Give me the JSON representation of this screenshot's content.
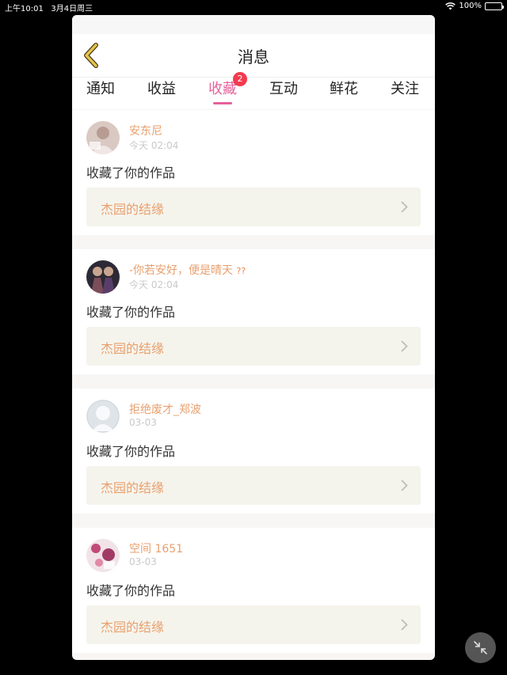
{
  "status_bar": {
    "time": "上午10:01",
    "date": "3月4日周三",
    "battery_percent": "100%",
    "wifi_icon": "wifi-icon",
    "battery_icon": "battery-icon",
    "battery_level": 1.0
  },
  "header": {
    "title": "消息",
    "back_icon": "chevron-left-icon"
  },
  "tabs": [
    {
      "label": "通知",
      "active": false,
      "badge": ""
    },
    {
      "label": "收益",
      "active": false,
      "badge": ""
    },
    {
      "label": "收藏",
      "active": true,
      "badge": "2"
    },
    {
      "label": "互动",
      "active": false,
      "badge": ""
    },
    {
      "label": "鲜花",
      "active": false,
      "badge": ""
    },
    {
      "label": "关注",
      "active": false,
      "badge": ""
    }
  ],
  "messages": [
    {
      "user": "安东尼",
      "time": "今天 02:04",
      "action": "收藏了你的作品",
      "work": "杰园的结缘"
    },
    {
      "user": "-你若安好，便是晴天",
      "emoji": "??",
      "time": "今天 02:04",
      "action": "收藏了你的作品",
      "work": "杰园的结缘"
    },
    {
      "user": "拒绝废才_郑波",
      "time": "03-03",
      "action": "收藏了你的作品",
      "work": "杰园的结缘"
    },
    {
      "user": "空间 1651",
      "time": "03-03",
      "action": "收藏了你的作品",
      "work": "杰园的结缘"
    }
  ],
  "colors": {
    "accent_pink": "#e7609a",
    "name_orange": "#e8a06f",
    "badge_red": "#f33a4f",
    "link_bg": "#f5f4ec",
    "back_arrow": "#e3c54a"
  },
  "floating": {
    "icon": "collapse-arrows-icon"
  }
}
